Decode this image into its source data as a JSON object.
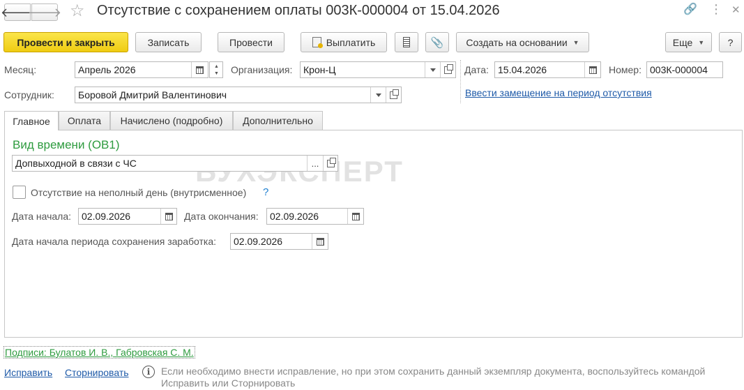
{
  "title": "Отсутствие с сохранением оплаты 003К-000004 от 15.04.2026",
  "icons": {
    "back": "arrow-left-icon",
    "forward": "arrow-right-icon",
    "favorite": "star-icon",
    "link": "link-icon",
    "more": "more-vertical-icon",
    "close": "close-icon"
  },
  "toolbar": {
    "post_and_close": "Провести и закрыть",
    "save": "Записать",
    "post": "Провести",
    "pay": "Выплатить",
    "create_based_on": "Создать на основании",
    "more": "Еще",
    "help": "?"
  },
  "header": {
    "month_label": "Месяц:",
    "month_value": "Апрель 2026",
    "org_label": "Организация:",
    "org_value": "Крон-Ц",
    "date_label": "Дата:",
    "date_value": "15.04.2026",
    "number_label": "Номер:",
    "number_value": "003К-000004",
    "employee_label": "Сотрудник:",
    "employee_value": "Боровой Дмитрий Валентинович",
    "replacement_link": "Ввести замещение на период отсутствия"
  },
  "tabs": [
    {
      "label": "Главное",
      "active": true
    },
    {
      "label": "Оплата",
      "active": false
    },
    {
      "label": "Начислено (подробно)",
      "active": false
    },
    {
      "label": "Дополнительно",
      "active": false
    }
  ],
  "main": {
    "time_type_title": "Вид времени (ОВ1)",
    "time_type_value": "Допвыходной в связи с ЧС",
    "part_day_label": "Отсутствие на неполный день (внутрисменное)",
    "part_day_checked": false,
    "help_mark": "?",
    "start_label": "Дата начала:",
    "start_value": "02.09.2026",
    "end_label": "Дата окончания:",
    "end_value": "02.09.2026",
    "period_start_label": "Дата начала периода сохранения заработка:",
    "period_start_value": "02.09.2026",
    "watermark": "БУХЭКСПЕРТ"
  },
  "footer": {
    "signatures": "Подписи: Булатов И. В., Габровская С. М.",
    "fix": "Исправить",
    "reverse": "Сторнировать",
    "info_text": "Если необходимо внести исправление, но при этом сохранить данный экземпляр документа, воспользуйтесь командой Исправить или Сторнировать"
  },
  "colors": {
    "primary_button": "#f5d420",
    "link": "#1e5aa8",
    "section_title": "#2e9b3f",
    "info_text": "#888888"
  }
}
